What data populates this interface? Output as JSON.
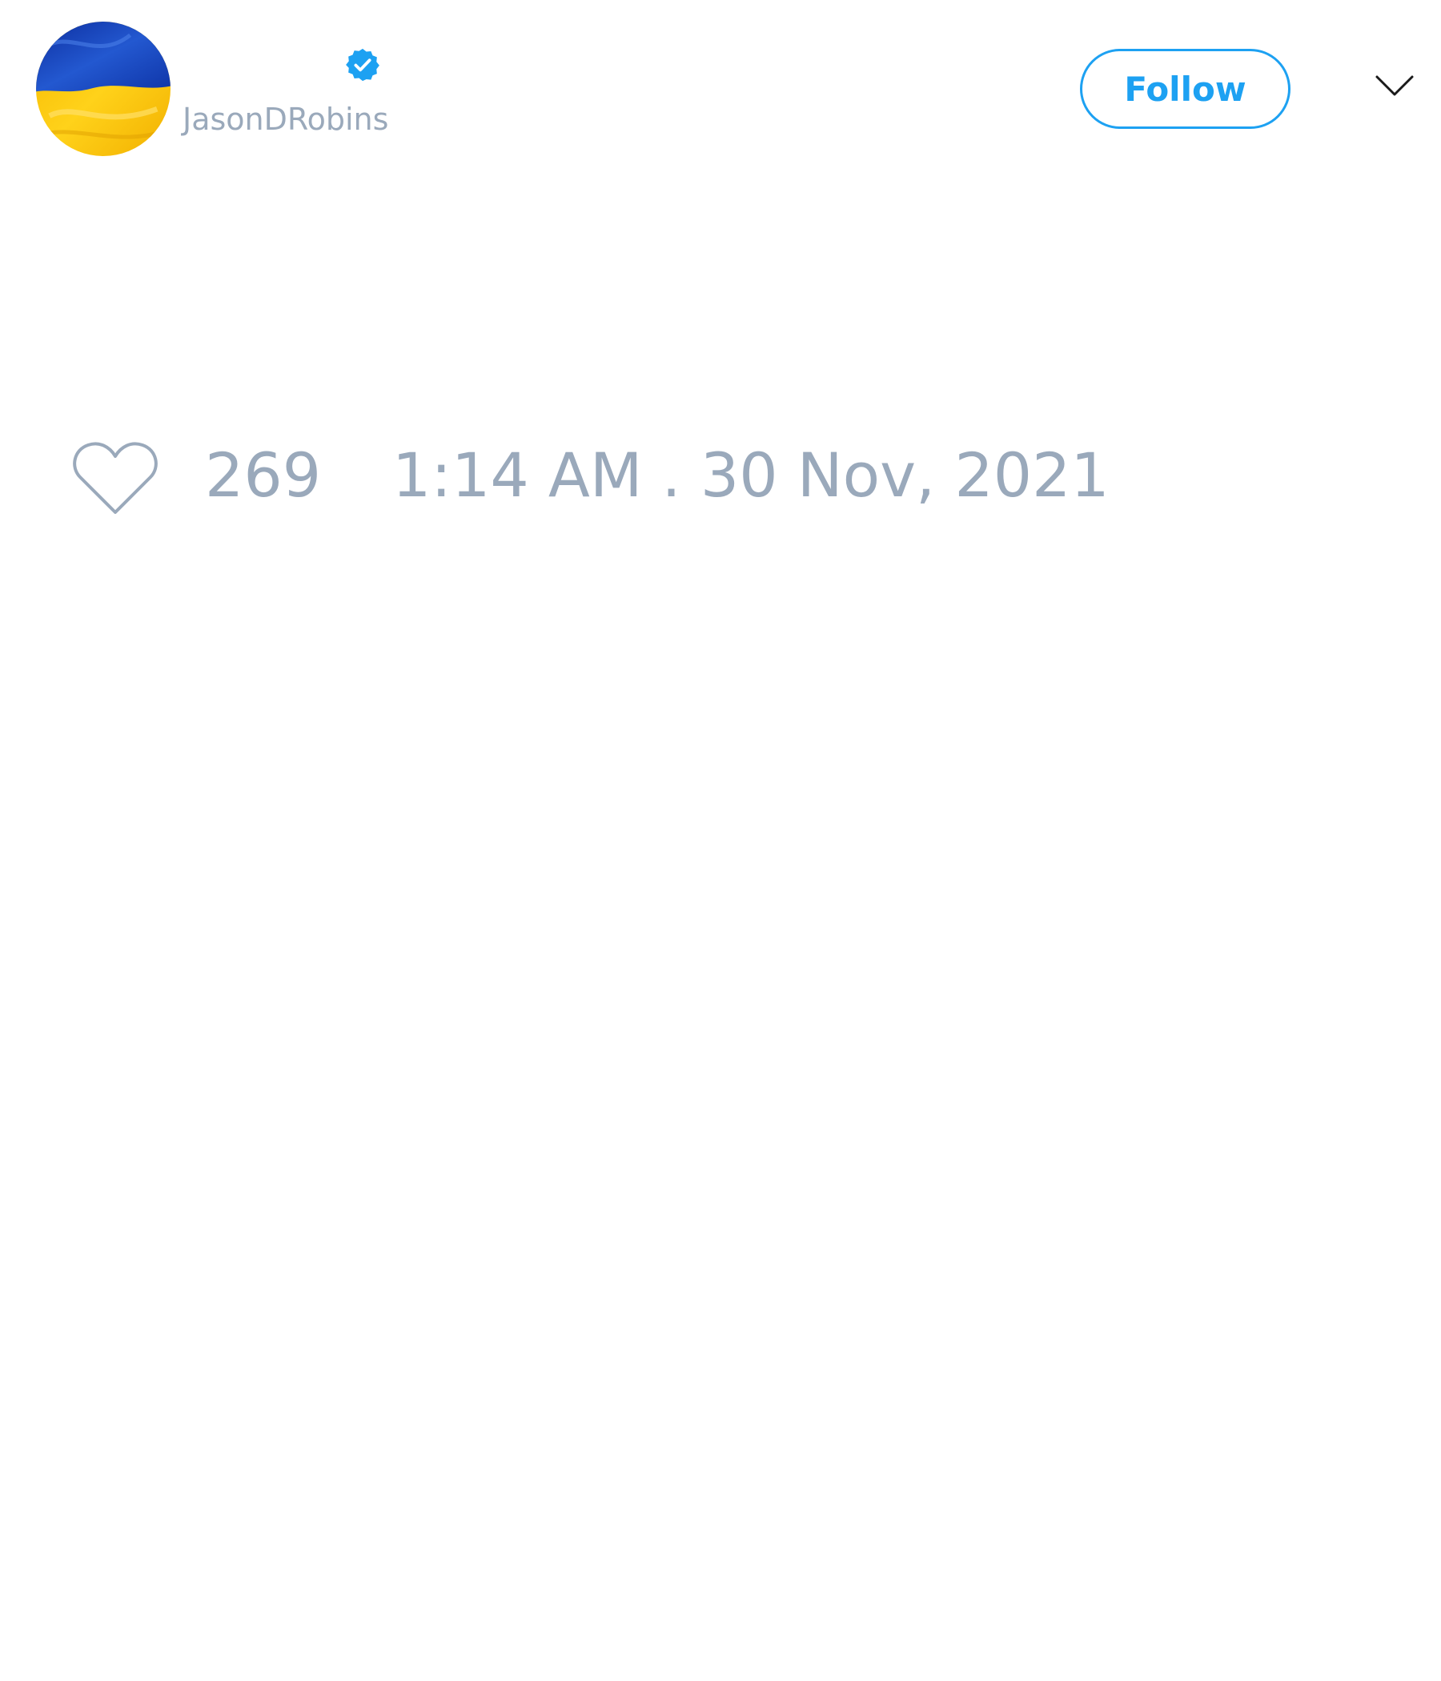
{
  "header": {
    "avatar_icon": "ukraine-flag-avatar",
    "verified_icon": "verified-badge-icon",
    "handle": "JasonDRobins",
    "follow_label": "Follow",
    "menu_icon": "chevron-down-icon"
  },
  "footer": {
    "like_icon": "heart-icon",
    "like_count": "269",
    "timestamp": "1:14 AM . 30 Nov, 2021"
  },
  "colors": {
    "accent": "#1da1f2",
    "muted_text": "#9aa9bb",
    "flag_blue": "#1a45b8",
    "flag_yellow": "#f7c300"
  }
}
